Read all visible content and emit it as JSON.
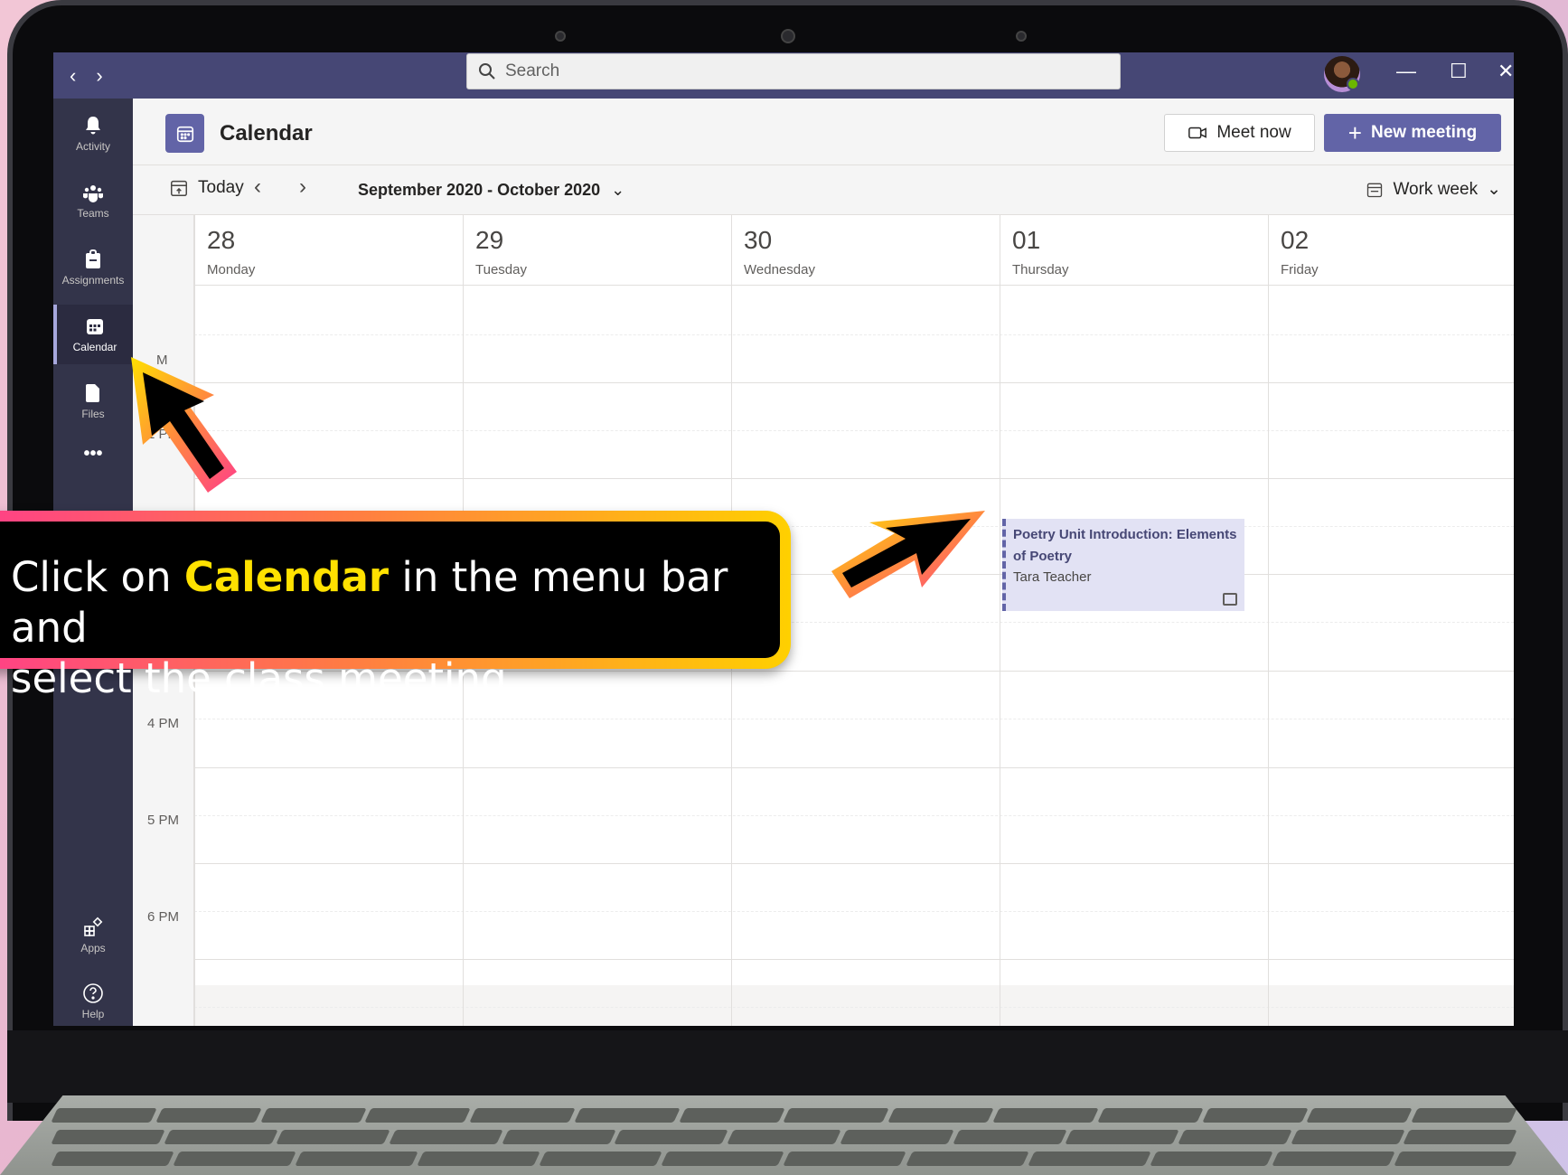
{
  "window": {
    "search_placeholder": "Search",
    "back_label": "‹",
    "forward_label": "›",
    "minimize": "—",
    "maximize": "☐",
    "close": "✕"
  },
  "rail": {
    "items": [
      {
        "label": "Activity",
        "icon": "bell-icon"
      },
      {
        "label": "Teams",
        "icon": "teams-icon"
      },
      {
        "label": "Assignments",
        "icon": "assignments-icon"
      },
      {
        "label": "Calendar",
        "icon": "calendar-icon",
        "active": true
      },
      {
        "label": "Files",
        "icon": "file-icon"
      },
      {
        "label": "•••",
        "icon": "more-icon"
      },
      {
        "label": "Apps",
        "icon": "apps-icon"
      },
      {
        "label": "Help",
        "icon": "help-icon"
      }
    ]
  },
  "header": {
    "title": "Calendar",
    "meet_now": "Meet now",
    "new_meeting": "New meeting"
  },
  "toolbar": {
    "today": "Today",
    "range": "September 2020 - October 2020",
    "view": "Work week"
  },
  "days": [
    {
      "num": "28",
      "name": "Monday"
    },
    {
      "num": "29",
      "name": "Tuesday"
    },
    {
      "num": "30",
      "name": "Wednesday"
    },
    {
      "num": "01",
      "name": "Thursday"
    },
    {
      "num": "02",
      "name": "Friday"
    }
  ],
  "times": [
    "1 PM",
    "4 PM",
    "5 PM",
    "6 PM"
  ],
  "partial_time": "M",
  "event": {
    "title": "Poetry Unit Introduction: Elements of Poetry",
    "organizer": "Tara Teacher"
  },
  "callout": {
    "line1_pre": "Click on ",
    "line1_highlight": "Calendar",
    "line1_post": " in the menu bar and",
    "line2": "select the class meeting."
  },
  "colors": {
    "brand": "#6264a7",
    "titlebar": "#464775",
    "rail": "#33344a",
    "event_bg": "#e2e2f4",
    "callout_highlight": "#ffe100"
  }
}
